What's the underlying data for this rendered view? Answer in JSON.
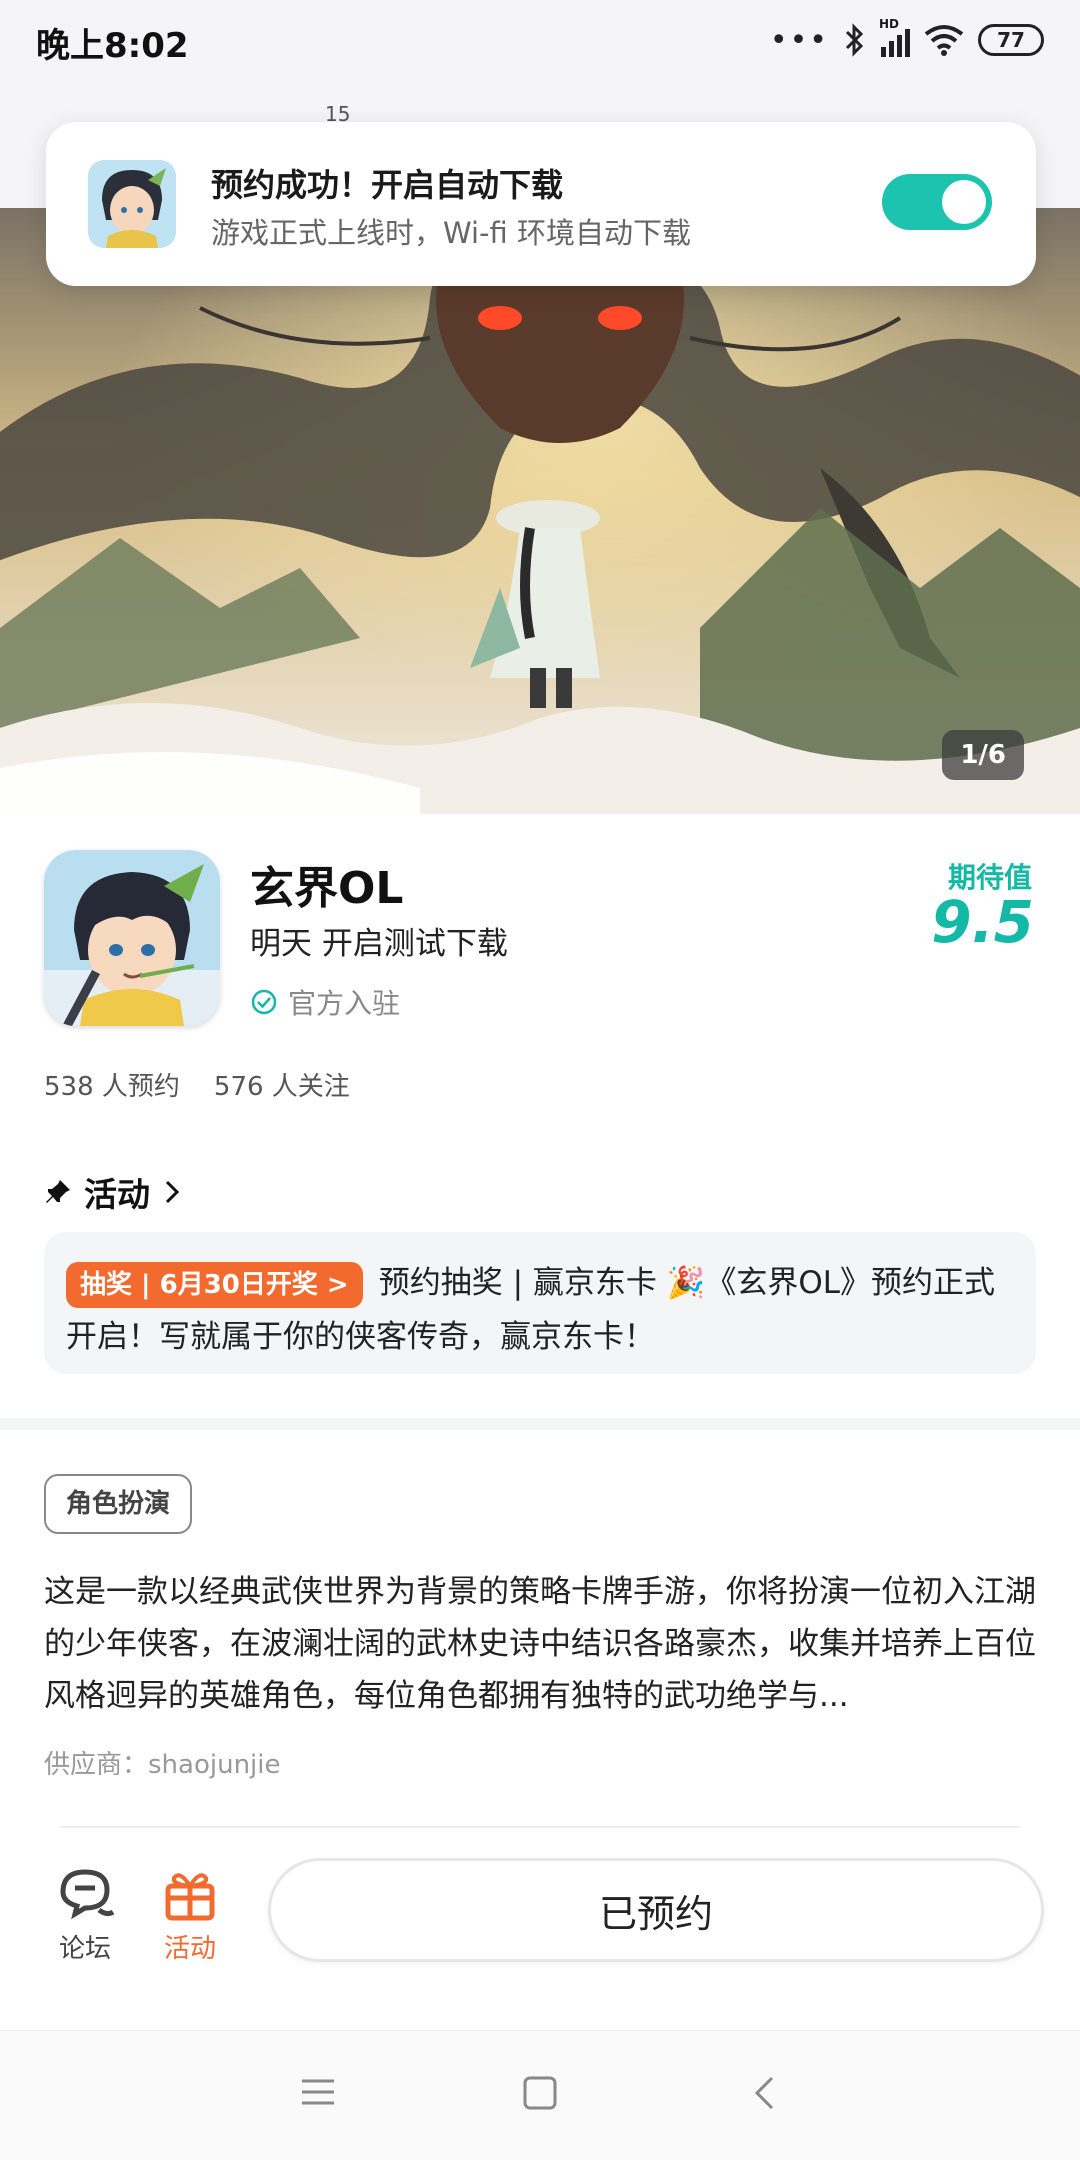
{
  "status_bar": {
    "time": "晚上8:02",
    "signal_label": "HD",
    "battery": "77"
  },
  "hidden_header": {
    "mini_text": "15"
  },
  "toast": {
    "title": "预约成功！开启自动下载",
    "subtitle": "游戏正式上线时，Wi-fi 环境自动下载",
    "toggle_on": true
  },
  "banner": {
    "counter": "1/6"
  },
  "app": {
    "name": "玄界OL",
    "status": "明天 开启测试下载",
    "verified": "官方入驻",
    "expect_label": "期待值",
    "expect_score": "9.5",
    "reservations": "538 人预约",
    "followers": "576 人关注"
  },
  "activity": {
    "header": "活动",
    "tag": "抽奖 | 6月30日开奖 >",
    "text": "预约抽奖 | 赢京东卡 🎉《玄界OL》预约正式开启！写就属于你的侠客传奇，赢京东卡！"
  },
  "details": {
    "genre": "角色扮演",
    "description": "这是一款以经典武侠世界为背景的策略卡牌手游，你将扮演一位初入江湖的少年侠客，在波澜壮阔的武林史诗中结识各路豪杰，收集并培养上百位风格迥异的英雄角色，每位角色都拥有独特的武功绝学与...",
    "supplier": "供应商：shaojunjie"
  },
  "action_bar": {
    "forum_label": "论坛",
    "activity_label": "活动",
    "reserve_label": "已预约"
  },
  "colors": {
    "accent": "#14b8a6",
    "orange": "#f26a2e",
    "toggle": "#1cc4b0"
  }
}
